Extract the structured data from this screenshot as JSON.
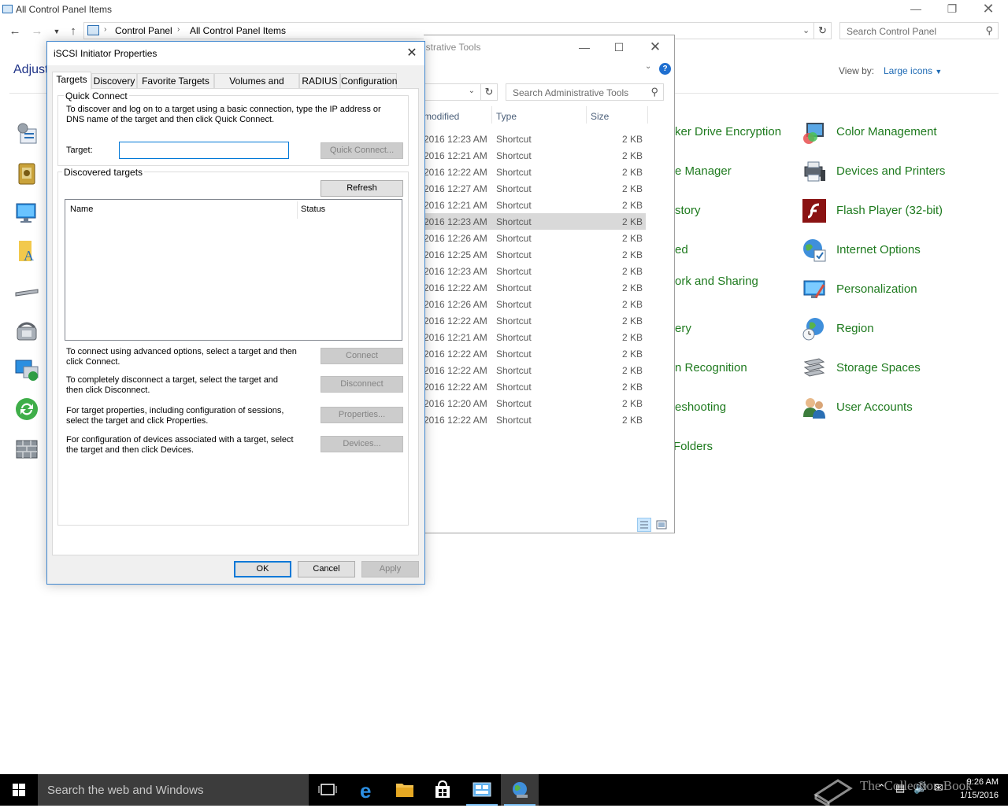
{
  "control_panel": {
    "title": "All Control Panel Items",
    "breadcrumb": [
      "Control Panel",
      "All Control Panel Items"
    ],
    "search_placeholder": "Search Control Panel",
    "heading_partial": "Adjust",
    "view_by_label": "View by:",
    "view_by_value": "Large icons",
    "middle_items": [
      "ker Drive Encryption",
      "e Manager",
      "story",
      "ed",
      "ork and Sharing",
      "ery",
      "n Recognition",
      "eshooting",
      "Folders"
    ],
    "right_items": [
      "Color Management",
      "Devices and Printers",
      "Flash Player (32-bit)",
      "Internet Options",
      "Personalization",
      "Region",
      "Storage Spaces",
      "User Accounts"
    ]
  },
  "admin_tools": {
    "title_partial": "istrative Tools",
    "search_placeholder": "Search Administrative Tools",
    "columns": [
      "modified",
      "Type",
      "Size"
    ],
    "rows": [
      {
        "modified": "2016 12:23 AM",
        "type": "Shortcut",
        "size": "2 KB"
      },
      {
        "modified": "2016 12:21 AM",
        "type": "Shortcut",
        "size": "2 KB"
      },
      {
        "modified": "2016 12:22 AM",
        "type": "Shortcut",
        "size": "2 KB"
      },
      {
        "modified": "2016 12:27 AM",
        "type": "Shortcut",
        "size": "2 KB"
      },
      {
        "modified": "2016 12:21 AM",
        "type": "Shortcut",
        "size": "2 KB"
      },
      {
        "modified": "2016 12:23 AM",
        "type": "Shortcut",
        "size": "2 KB"
      },
      {
        "modified": "2016 12:26 AM",
        "type": "Shortcut",
        "size": "2 KB"
      },
      {
        "modified": "2016 12:25 AM",
        "type": "Shortcut",
        "size": "2 KB"
      },
      {
        "modified": "2016 12:23 AM",
        "type": "Shortcut",
        "size": "2 KB"
      },
      {
        "modified": "2016 12:22 AM",
        "type": "Shortcut",
        "size": "2 KB"
      },
      {
        "modified": "2016 12:26 AM",
        "type": "Shortcut",
        "size": "2 KB"
      },
      {
        "modified": "2016 12:22 AM",
        "type": "Shortcut",
        "size": "2 KB"
      },
      {
        "modified": "2016 12:21 AM",
        "type": "Shortcut",
        "size": "2 KB"
      },
      {
        "modified": "2016 12:22 AM",
        "type": "Shortcut",
        "size": "2 KB"
      },
      {
        "modified": "2016 12:22 AM",
        "type": "Shortcut",
        "size": "2 KB"
      },
      {
        "modified": "2016 12:22 AM",
        "type": "Shortcut",
        "size": "2 KB"
      },
      {
        "modified": "2016 12:20 AM",
        "type": "Shortcut",
        "size": "2 KB"
      },
      {
        "modified": "2016 12:22 AM",
        "type": "Shortcut",
        "size": "2 KB"
      }
    ],
    "selected_row": 5
  },
  "dialog": {
    "title": "iSCSI Initiator Properties",
    "tabs": [
      "Targets",
      "Discovery",
      "Favorite Targets",
      "Volumes and Devices",
      "RADIUS",
      "Configuration"
    ],
    "active_tab": "Targets",
    "quick_connect": {
      "group_label": "Quick Connect",
      "description": "To discover and log on to a target using a basic connection, type the IP address or DNS name of the target and then click Quick Connect.",
      "target_label": "Target:",
      "target_value": "",
      "button": "Quick Connect..."
    },
    "discovered": {
      "group_label": "Discovered targets",
      "refresh_button": "Refresh",
      "columns": [
        "Name",
        "Status"
      ],
      "connect_text": "To connect using advanced options, select a target and then click Connect.",
      "connect_button": "Connect",
      "disconnect_text": "To completely disconnect a target, select the target and then click Disconnect.",
      "disconnect_button": "Disconnect",
      "properties_text": "For target properties, including configuration of sessions, select the target and click Properties.",
      "properties_button": "Properties...",
      "devices_text": "For configuration of devices associated with a target, select the target and then click Devices.",
      "devices_button": "Devices..."
    },
    "ok_button": "OK",
    "cancel_button": "Cancel",
    "apply_button": "Apply"
  },
  "taskbar": {
    "search_placeholder": "Search the web and Windows",
    "time": "9:26 AM",
    "date": "1/15/2016",
    "watermark": "The Collection Book"
  }
}
